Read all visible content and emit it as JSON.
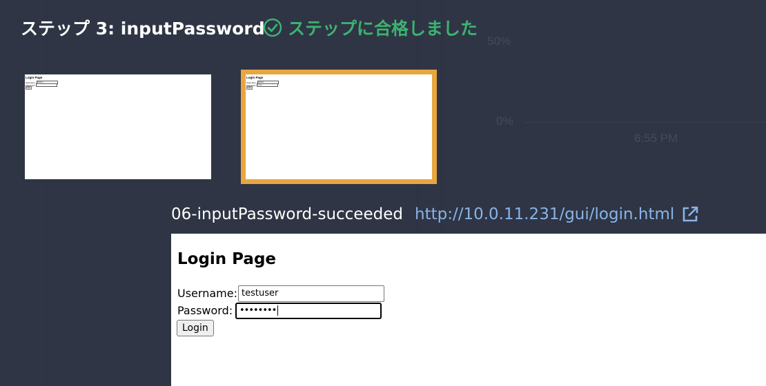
{
  "header": {
    "step_title": "ステップ 3: inputPassword",
    "status_text": "ステップに合格しました",
    "status_color": "#3cb371",
    "status_icon": "check-circle-icon"
  },
  "background_chart": {
    "y_tick_top": "50%",
    "y_tick_bottom": "0%",
    "x_tick": "6:55 PM"
  },
  "thumbnails": [
    {
      "selected": false,
      "mini_title": "Login Page",
      "mini_username_label": "Username:",
      "mini_username_value": "testuser",
      "mini_password_label": "Password:",
      "mini_password_value": "",
      "mini_button": "Login"
    },
    {
      "selected": true,
      "border_color": "#e8a640",
      "mini_title": "Login Page",
      "mini_username_label": "Username:",
      "mini_username_value": "testuser",
      "mini_password_label": "Password:",
      "mini_password_value": "••••••••",
      "mini_button": "Login"
    }
  ],
  "caption": {
    "name": "06-inputPassword-succeeded",
    "url": "http://10.0.11.231/gui/login.html",
    "url_color": "#89b4e8",
    "link_icon": "external-link-icon"
  },
  "preview": {
    "title": "Login Page",
    "username_label": "Username:",
    "username_value": "testuser",
    "password_label": "Password:",
    "password_value": "••••••••",
    "login_button": "Login"
  }
}
